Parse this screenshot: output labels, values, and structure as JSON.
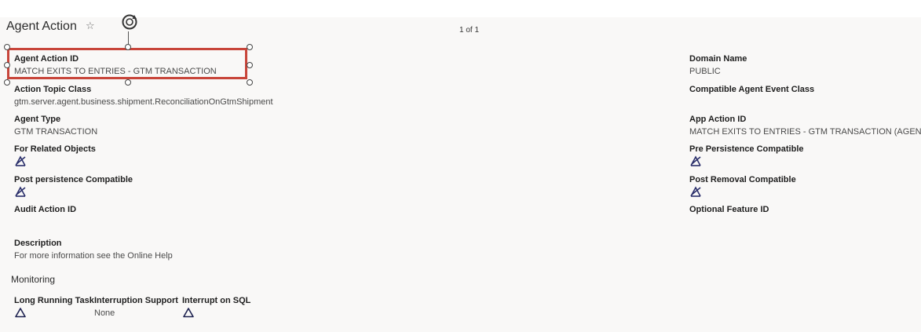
{
  "header": {
    "title": "Agent Action",
    "favorite_icon": "star-outline-icon",
    "pager": "1 of 1"
  },
  "fields": {
    "agent_action_id": {
      "label": "Agent Action ID",
      "value": "MATCH EXITS TO ENTRIES - GTM TRANSACTION"
    },
    "domain_name": {
      "label": "Domain Name",
      "value": "PUBLIC"
    },
    "action_topic_class": {
      "label": "Action Topic Class",
      "value": "gtm.server.agent.business.shipment.ReconciliationOnGtmShipment"
    },
    "compatible_agent_event_class": {
      "label": "Compatible Agent Event Class",
      "value": ""
    },
    "agent_type": {
      "label": "Agent Type",
      "value": "GTM TRANSACTION"
    },
    "app_action_id": {
      "label": "App Action ID",
      "value": "MATCH EXITS TO ENTRIES - GTM TRANSACTION (AGENT)"
    },
    "for_related_objects": {
      "label": "For Related Objects",
      "icon": "unchecked-icon"
    },
    "pre_persistence_compatible": {
      "label": "Pre Persistence Compatible",
      "icon": "unchecked-icon"
    },
    "post_persistence_compatible": {
      "label": "Post persistence Compatible",
      "icon": "unchecked-icon"
    },
    "post_removal_compatible": {
      "label": "Post Removal Compatible",
      "icon": "unchecked-icon"
    },
    "audit_action_id": {
      "label": "Audit Action ID",
      "value": ""
    },
    "optional_feature_id": {
      "label": "Optional Feature ID",
      "value": ""
    },
    "description": {
      "label": "Description",
      "value": "For more information see the Online Help"
    }
  },
  "monitoring": {
    "title": "Monitoring",
    "long_running_task": {
      "label": "Long Running Task",
      "icon": "triangle-outline-icon"
    },
    "interruption_support": {
      "label": "Interruption Support",
      "value": "None"
    },
    "interrupt_on_sql": {
      "label": "Interrupt on SQL",
      "icon": "triangle-outline-icon"
    }
  },
  "colors": {
    "selection_border": "#c8453a",
    "check_icon": "#2a2f6b",
    "background": "#f9f8f7"
  }
}
